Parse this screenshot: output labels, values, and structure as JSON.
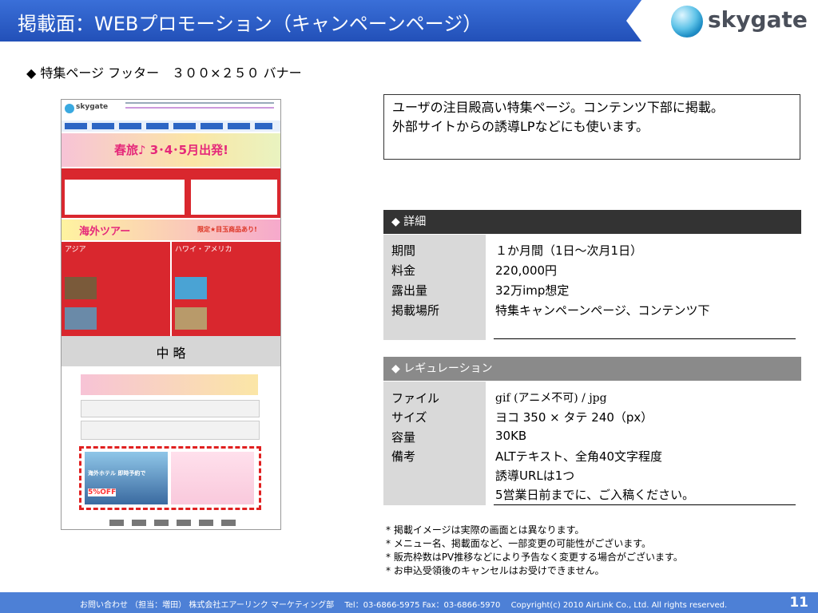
{
  "header": {
    "title": "掲載面：WEBプロモーション（キャンペーンページ）",
    "logo_text": "skygate"
  },
  "subheading": "◆ 特集ページ フッター　３００×２５０ バナー",
  "mockup": {
    "ellipsis_label": "中 略",
    "banner_text": "春旅♪ 3･4･5月出発!",
    "tour_text": "海外ツアー",
    "promo_text": "限定★目玉商品あり!",
    "asia_text": "アジア",
    "hawaii_text": "ハワイ・アメリカ",
    "hotel_text": "海外ホテル 即時予約で",
    "discount": "5%OFF"
  },
  "description": [
    "ユーザの注目殿高い特集ページ。コンテンツ下部に掲載。",
    "外部サイトからの誘導LPなどにも使います。"
  ],
  "details": {
    "header": "◆ 詳細",
    "rows": [
      {
        "label": "期間",
        "value": "１か月間（1日～次月1日）"
      },
      {
        "label": "料金",
        "value": "220,000円"
      },
      {
        "label": "露出量",
        "value": "32万imp想定"
      },
      {
        "label": "掲載場所",
        "value": "特集キャンペーンページ、コンテンツ下"
      }
    ]
  },
  "regulation": {
    "header": "◆ レギュレーション",
    "rows": [
      {
        "label": "ファイル",
        "value": "gif (アニメ不可) / jpg"
      },
      {
        "label": "サイズ",
        "value": "ヨコ 350 × タテ 240（px）"
      },
      {
        "label": "容量",
        "value": "30KB"
      },
      {
        "label": "備考",
        "value": "ALTテキスト、全角40文字程度"
      }
    ],
    "extra": [
      "誘導URLは1つ",
      "5営業日前までに、ご入稿ください。"
    ]
  },
  "notes": [
    "* 掲載イメージは実際の画面とは異なります。",
    "* メニュー名、掲載面など、一部変更の可能性がございます。",
    "* 販売枠数はPV推移などにより予告なく変更する場合がございます。",
    "* お申込受領後のキャンセルはお受けできません。"
  ],
  "footer": {
    "text": "お問い合わせ （担当：増田） 株式会社エアーリンク マーケティング部　 Tel：03-6866-5975  Fax：03-6866-5970　 Copyright(c) 2010  AirLink Co., Ltd. All rights reserved.",
    "page": "11"
  },
  "colors": {
    "header_blue": "#2e5fcc",
    "footer_blue": "#4d80d6",
    "dark_bar": "#333333",
    "gray_bar": "#8a8a8a",
    "label_gray": "#d9d9d9"
  }
}
